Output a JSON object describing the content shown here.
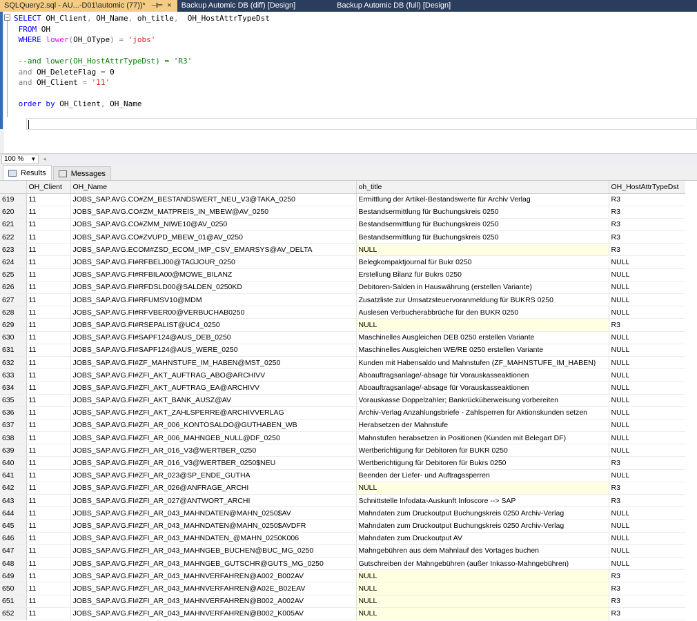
{
  "tabs": {
    "active": {
      "label": "SQLQuery2.sql - AU...-D01\\automic (77))*",
      "pin": "⊣⊨",
      "close": "×"
    },
    "others": [
      "Backup Automic DB (diff) [Design]",
      "Backup Automic DB (full) [Design]"
    ]
  },
  "zoom": {
    "value": "100 %"
  },
  "results_tabs": [
    "Results",
    "Messages"
  ],
  "columns": [
    "",
    "OH_Client",
    "OH_Name",
    "oh_title",
    "OH_HostAttrTypeDst"
  ],
  "rows": [
    [
      "619",
      "11",
      "JOBS_SAP.AVG.CO#ZM_BESTANDSWERT_NEU_V3@TAKA_0250",
      "Ermittlung der Artikel-Bestandswerte für Archiv Verlag",
      "R3"
    ],
    [
      "620",
      "11",
      "JOBS_SAP.AVG.CO#ZM_MATPREIS_IN_MBEW@AV_0250",
      "Bestandsermittlung für Buchungskreis 0250",
      "R3"
    ],
    [
      "621",
      "11",
      "JOBS_SAP.AVG.CO#ZMM_NIWE10@AV_0250",
      "Bestandsermittlung für Buchungskreis 0250",
      "R3"
    ],
    [
      "622",
      "11",
      "JOBS_SAP.AVG.CO#ZVUPD_MBEW_01@AV_0250",
      "Bestandsermittlung für Buchungskreis 0250",
      "R3"
    ],
    [
      "623",
      "11",
      "JOBS_SAP.AVG.ECOM#ZSD_ECOM_IMP_CSV_EMARSYS@AV_DELTA",
      "NULL",
      "R3"
    ],
    [
      "624",
      "11",
      "JOBS_SAP.AVG.FI#RFBELJ00@TAGJOUR_0250",
      "Belegkompaktjournal für Bukr 0250",
      "NULL"
    ],
    [
      "625",
      "11",
      "JOBS_SAP.AVG.FI#RFBILA00@MOWE_BILANZ",
      "Erstellung Bilanz für Bukrs 0250",
      "NULL"
    ],
    [
      "626",
      "11",
      "JOBS_SAP.AVG.FI#RFDSLD00@SALDEN_0250KD",
      "Debitoren-Salden in Hauswährung (erstellen Variante)",
      "NULL"
    ],
    [
      "627",
      "11",
      "JOBS_SAP.AVG.FI#RFUMSV10@MDM",
      "Zusatzliste zur Umsatzsteuervoranmeldung für BUKRS 0250",
      "NULL"
    ],
    [
      "628",
      "11",
      "JOBS_SAP.AVG.FI#RFVBER00@VERBUCHAB0250",
      "Auslesen Verbucherabbrüche für den BUKR 0250",
      "NULL"
    ],
    [
      "629",
      "11",
      "JOBS_SAP.AVG.FI#RSEPALIST@UC4_0250",
      "NULL",
      "R3"
    ],
    [
      "630",
      "11",
      "JOBS_SAP.AVG.FI#SAPF124@AUS_DEB_0250",
      "Maschinelles Ausgleichen DEB 0250 erstellen Variante",
      "NULL"
    ],
    [
      "631",
      "11",
      "JOBS_SAP.AVG.FI#SAPF124@AUS_WERE_0250",
      "Maschinelles Ausgleichen WE/RE 0250 erstellen Variante",
      "NULL"
    ],
    [
      "632",
      "11",
      "JOBS_SAP.AVG.FI#ZF_MAHNSTUFE_IM_HABEN@MST_0250",
      "Kunden mit Habensaldo und Mahnstufen  (ZF_MAHNSTUFE_IM_HABEN)",
      "NULL"
    ],
    [
      "633",
      "11",
      "JOBS_SAP.AVG.FI#ZFI_AKT_AUFTRAG_ABO@ARCHIVV",
      "Aboauftragsanlage/-absage für Vorauskasseaktionen",
      "NULL"
    ],
    [
      "634",
      "11",
      "JOBS_SAP.AVG.FI#ZFI_AKT_AUFTRAG_EA@ARCHIVV",
      "Aboauftragsanlage/-absage für Vorauskasseaktionen",
      "NULL"
    ],
    [
      "635",
      "11",
      "JOBS_SAP.AVG.FI#ZFI_AKT_BANK_AUSZ@AV",
      "Vorauskasse Doppelzahler; Bankrücküberweisung vorbereiten",
      "NULL"
    ],
    [
      "636",
      "11",
      "JOBS_SAP.AVG.FI#ZFI_AKT_ZAHLSPERRE@ARCHIVVERLAG",
      "Archiv-Verlag Anzahlungsbriefe - Zahlsperren für Aktionskunden setzen",
      "NULL"
    ],
    [
      "637",
      "11",
      "JOBS_SAP.AVG.FI#ZFI_AR_006_KONTOSALDO@GUTHABEN_WB",
      "Herabsetzen der Mahnstufe",
      "NULL"
    ],
    [
      "638",
      "11",
      "JOBS_SAP.AVG.FI#ZFI_AR_006_MAHNGEB_NULL@DF_0250",
      "Mahnstufen herabsetzen in Positionen (Kunden mit Belegart DF)",
      "NULL"
    ],
    [
      "639",
      "11",
      "JOBS_SAP.AVG.FI#ZFI_AR_016_V3@WERTBER_0250",
      "Wertberichtigung für Debitoren für BUKR 0250",
      "NULL"
    ],
    [
      "640",
      "11",
      "JOBS_SAP.AVG.FI#ZFI_AR_016_V3@WERTBER_0250$NEU",
      "Wertberichtigung für Debitoren für Bukrs 0250",
      "R3"
    ],
    [
      "641",
      "11",
      "JOBS_SAP.AVG.FI#ZFI_AR_023@SP_ENDE_GUTHA",
      "Beenden der Liefer- und Auftragssperren",
      "NULL"
    ],
    [
      "642",
      "11",
      "JOBS_SAP.AVG.FI#ZFI_AR_026@ANFRAGE_ARCHI",
      "NULL",
      "R3"
    ],
    [
      "643",
      "11",
      "JOBS_SAP.AVG.FI#ZFI_AR_027@ANTWORT_ARCHI",
      "Schnittstelle Infodata-Auskunft  Infoscore --> SAP",
      "R3"
    ],
    [
      "644",
      "11",
      "JOBS_SAP.AVG.FI#ZFI_AR_043_MAHNDATEN@MAHN_0250$AV",
      "Mahndaten zum Druckoutput Buchungskreis 0250 Archiv-Verlag",
      "NULL"
    ],
    [
      "645",
      "11",
      "JOBS_SAP.AVG.FI#ZFI_AR_043_MAHNDATEN@MAHN_0250$AVDFR",
      "Mahndaten zum Druckoutput Buchungskreis 0250 Archiv-Verlag",
      "NULL"
    ],
    [
      "646",
      "11",
      "JOBS_SAP.AVG.FI#ZFI_AR_043_MAHNDATEN_@MAHN_0250K006",
      "Mahndaten zum Druckoutput AV",
      "NULL"
    ],
    [
      "647",
      "11",
      "JOBS_SAP.AVG.FI#ZFI_AR_043_MAHNGEB_BUCHEN@BUC_MG_0250",
      "Mahngebühren aus dem Mahnlauf des Vortages buchen",
      "NULL"
    ],
    [
      "648",
      "11",
      "JOBS_SAP.AVG.FI#ZFI_AR_043_MAHNGEB_GUTSCHR@GUTS_MG_0250",
      "Gutschreiben der Mahngebühren (außer Inkasso-Mahngebühren)",
      "NULL"
    ],
    [
      "649",
      "11",
      "JOBS_SAP.AVG.FI#ZFI_AR_043_MAHNVERFAHREN@A002_B002AV",
      "NULL",
      "R3"
    ],
    [
      "650",
      "11",
      "JOBS_SAP.AVG.FI#ZFI_AR_043_MAHNVERFAHREN@A02E_B02EAV",
      "NULL",
      "R3"
    ],
    [
      "651",
      "11",
      "JOBS_SAP.AVG.FI#ZFI_AR_043_MAHNVERFAHREN@B002_A002AV",
      "NULL",
      "R3"
    ],
    [
      "652",
      "11",
      "JOBS_SAP.AVG.FI#ZFI_AR_043_MAHNVERFAHREN@B002_K005AV",
      "NULL",
      "R3"
    ]
  ]
}
